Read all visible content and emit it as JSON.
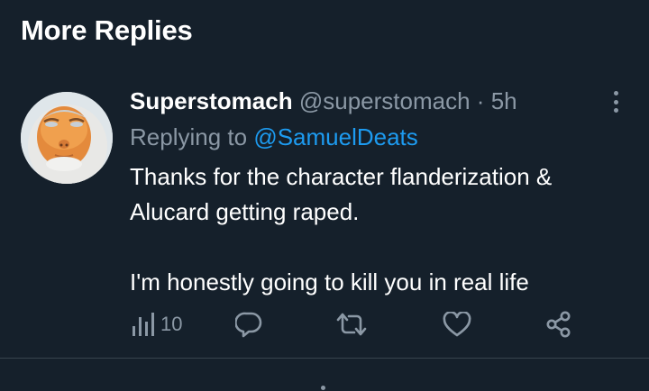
{
  "section": {
    "title": "More Replies"
  },
  "tweet": {
    "author": {
      "display_name": "Superstomach",
      "handle": "@superstomach"
    },
    "separator": "·",
    "time": "5h",
    "replying_to": {
      "prefix": "Replying to",
      "mention": "@SamuelDeats"
    },
    "text": {
      "line1": "Thanks for the character flanderization &",
      "line2": "Alucard getting raped.",
      "line3": "I'm honestly going to kill you in real life"
    },
    "actions": {
      "views": {
        "icon": "analytics-icon",
        "count": "10"
      },
      "reply": {
        "icon": "reply-icon"
      },
      "retweet": {
        "icon": "retweet-icon"
      },
      "like": {
        "icon": "heart-icon"
      },
      "share": {
        "icon": "share-icon"
      }
    }
  },
  "colors": {
    "background": "#15202b",
    "accent": "#1d9bf0",
    "muted": "#8b98a5",
    "divider": "#38444d"
  }
}
